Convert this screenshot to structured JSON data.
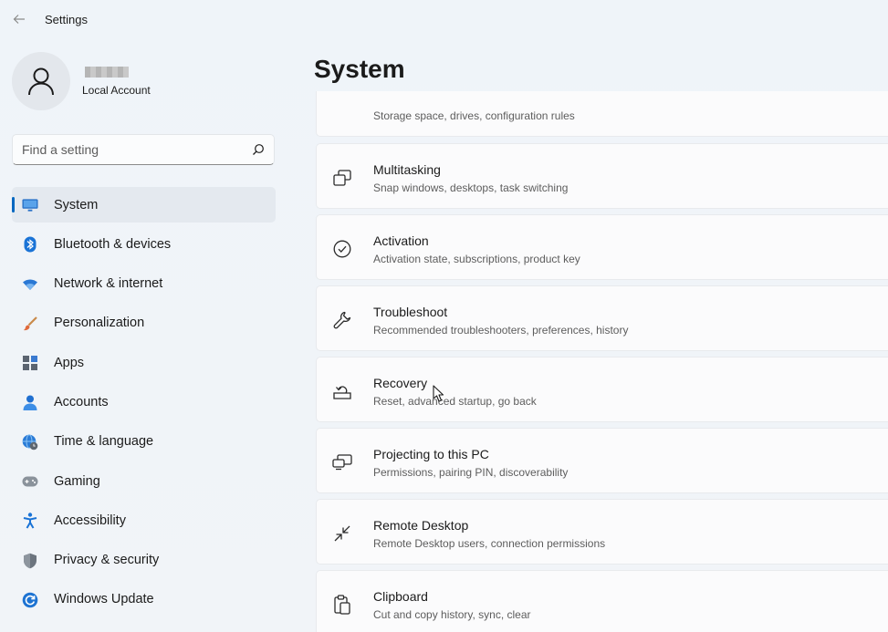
{
  "window": {
    "title": "Settings"
  },
  "profile": {
    "account_type": "Local Account"
  },
  "search": {
    "placeholder": "Find a setting"
  },
  "nav": [
    {
      "label": "System",
      "icon": "monitor-icon",
      "active": true
    },
    {
      "label": "Bluetooth & devices",
      "icon": "bluetooth-icon"
    },
    {
      "label": "Network & internet",
      "icon": "wifi-icon"
    },
    {
      "label": "Personalization",
      "icon": "brush-icon"
    },
    {
      "label": "Apps",
      "icon": "apps-icon"
    },
    {
      "label": "Accounts",
      "icon": "person-icon"
    },
    {
      "label": "Time & language",
      "icon": "globe-clock-icon"
    },
    {
      "label": "Gaming",
      "icon": "gamepad-icon"
    },
    {
      "label": "Accessibility",
      "icon": "accessibility-icon"
    },
    {
      "label": "Privacy & security",
      "icon": "shield-icon"
    },
    {
      "label": "Windows Update",
      "icon": "update-icon"
    }
  ],
  "main": {
    "title": "System",
    "cards": [
      {
        "title": "",
        "subtitle": "Storage space, drives, configuration rules",
        "icon": "storage-icon"
      },
      {
        "title": "Multitasking",
        "subtitle": "Snap windows, desktops, task switching",
        "icon": "multitasking-icon"
      },
      {
        "title": "Activation",
        "subtitle": "Activation state, subscriptions, product key",
        "icon": "check-circle-icon"
      },
      {
        "title": "Troubleshoot",
        "subtitle": "Recommended troubleshooters, preferences, history",
        "icon": "wrench-icon"
      },
      {
        "title": "Recovery",
        "subtitle": "Reset, advanced startup, go back",
        "icon": "recovery-icon"
      },
      {
        "title": "Projecting to this PC",
        "subtitle": "Permissions, pairing PIN, discoverability",
        "icon": "projecting-icon"
      },
      {
        "title": "Remote Desktop",
        "subtitle": "Remote Desktop users, connection permissions",
        "icon": "remote-desktop-icon"
      },
      {
        "title": "Clipboard",
        "subtitle": "Cut and copy history, sync, clear",
        "icon": "clipboard-icon"
      }
    ]
  },
  "colors": {
    "accent": "#0067c0",
    "background": "#eef3f8",
    "card": "#fbfbfc"
  }
}
